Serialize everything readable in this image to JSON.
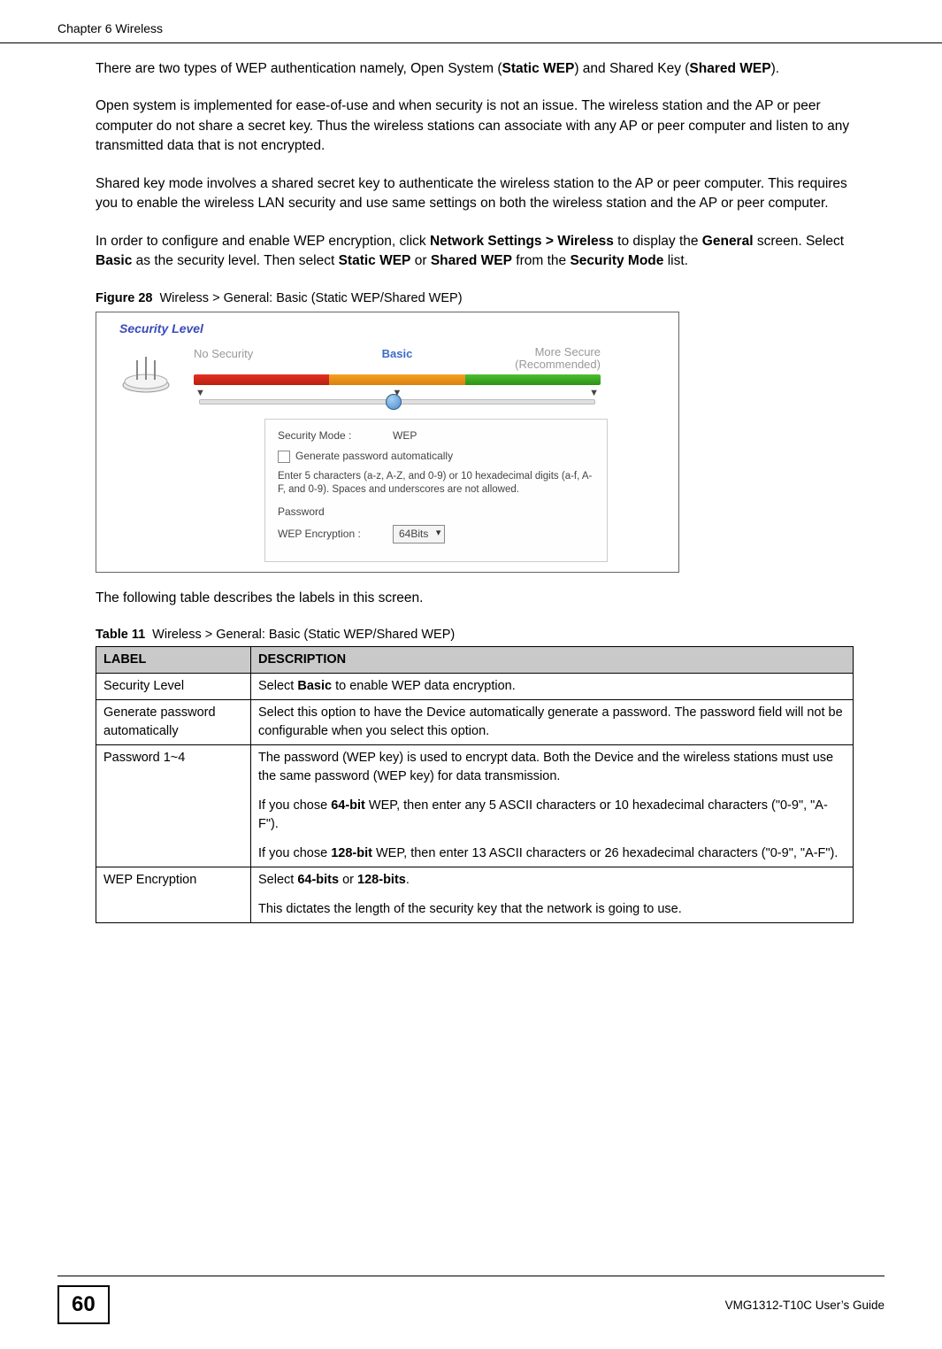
{
  "header": {
    "chapter": "Chapter 6 Wireless"
  },
  "paras": {
    "p1a": "There are two types of WEP authentication namely, Open System (",
    "p1b": "Static WEP",
    "p1c": ") and Shared Key (",
    "p1d": "Shared WEP",
    "p1e": ").",
    "p2": "Open system is implemented for ease-of-use and when security is not an issue. The wireless station and the AP or peer computer do not share a secret key. Thus the wireless stations can associate with any AP or peer computer and listen to any transmitted data that is not encrypted.",
    "p3": "Shared key mode involves a shared secret key to authenticate the wireless station to the AP or peer computer. This requires you to enable the wireless LAN security and use same settings on both the wireless station and the AP or peer computer.",
    "p4a": "In order to configure and enable WEP encryption, click ",
    "p4b": "Network Settings > Wireless",
    "p4c": " to display the ",
    "p4d": "General",
    "p4e": " screen. Select ",
    "p4f": "Basic",
    "p4g": " as the security level. Then select ",
    "p4h": "Static WEP",
    "p4i": " or ",
    "p4j": "Shared WEP",
    "p4k": " from the ",
    "p4l": "Security Mode",
    "p4m": " list.",
    "below_fig": "The following table describes the labels in this screen."
  },
  "figure": {
    "num": "Figure 28",
    "title": "Wireless > General: Basic (Static WEP/Shared WEP)",
    "security_level": "Security Level",
    "labels": {
      "no": "No Security",
      "basic": "Basic",
      "more1": "More Secure",
      "more2": "(Recommended)"
    },
    "panel": {
      "mode_label": "Security Mode :",
      "mode_value": "WEP",
      "gen_label": "Generate password automatically",
      "hint": "Enter 5 characters (a-z, A-Z, and 0-9) or 10 hexadecimal digits (a-f, A-F, and 0-9). Spaces and underscores are not allowed.",
      "pw_label": "Password",
      "enc_label": "WEP Encryption :",
      "enc_value": "64Bits"
    }
  },
  "table": {
    "num": "Table 11",
    "title": "Wireless > General: Basic (Static WEP/Shared WEP)",
    "headers": {
      "label": "LABEL",
      "desc": "DESCRIPTION"
    },
    "rows": [
      {
        "label": "Security Level",
        "d1a": "Select ",
        "d1b": "Basic",
        "d1c": " to enable WEP data encryption."
      },
      {
        "label": "Generate password automatically",
        "d1": "Select this option to have the Device automatically generate a password. The password field will not be configurable when you select this option."
      },
      {
        "label": "Password 1~4",
        "d1": "The password (WEP key) is used to encrypt data. Both the Device and the wireless stations must use the same password (WEP key) for data transmission.",
        "d2a": "If you chose ",
        "d2b": "64-bit",
        "d2c": " WEP, then enter any 5 ASCII characters or 10 hexadecimal characters (\"0-9\", \"A-F\").",
        "d3a": "If you chose ",
        "d3b": "128-bit",
        "d3c": " WEP, then enter 13 ASCII characters or 26 hexadecimal characters (\"0-9\", \"A-F\")."
      },
      {
        "label": "WEP Encryption",
        "d1a": "Select ",
        "d1b": "64-bits",
        "d1c": " or ",
        "d1d": "128-bits",
        "d1e": ".",
        "d2": "This dictates the length of the security key that the network is going to use."
      }
    ]
  },
  "footer": {
    "page": "60",
    "guide": "VMG1312-T10C User’s Guide"
  }
}
